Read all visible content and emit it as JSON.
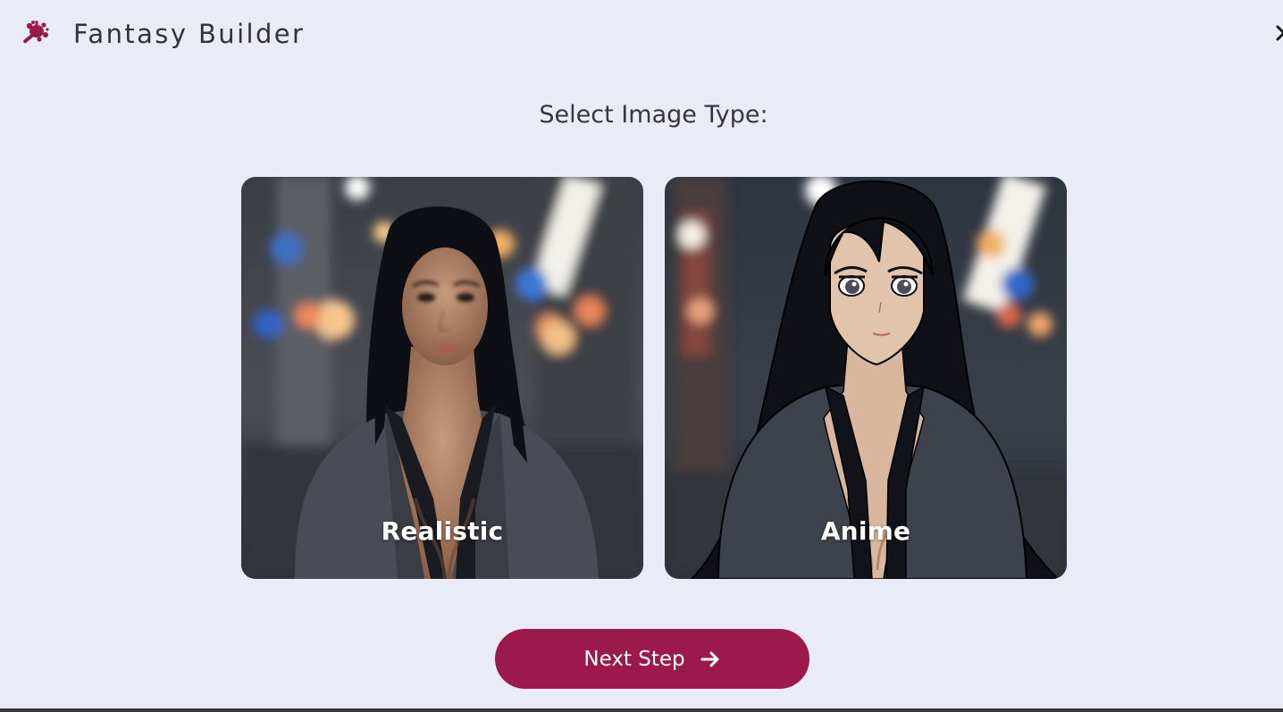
{
  "header": {
    "title": "Fantasy Builder",
    "logo_icon": "splat-magic-wand-icon",
    "close_icon": "close-icon"
  },
  "heading": "Select Image Type:",
  "image_types": [
    {
      "label": "Realistic",
      "style": "photo"
    },
    {
      "label": "Anime",
      "style": "illustration"
    }
  ],
  "next_button": {
    "label": "Next Step",
    "icon": "arrow-right-icon"
  },
  "colors": {
    "background": "#e9ecf6",
    "accent": "#9b1a4b",
    "text": "#3a3342"
  }
}
